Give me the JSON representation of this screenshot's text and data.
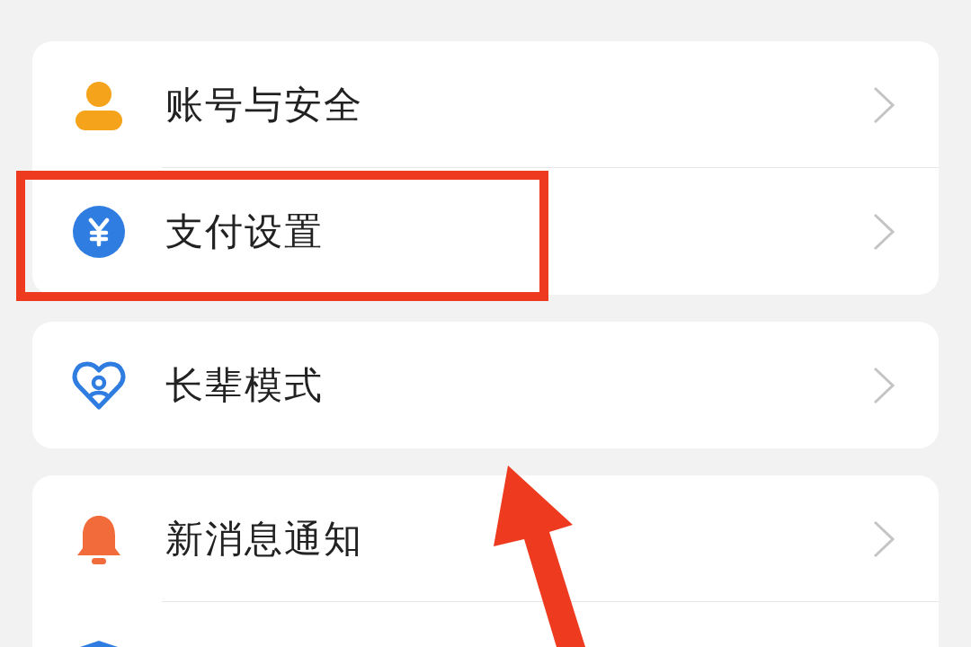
{
  "groups": [
    {
      "items": [
        {
          "kind": "account",
          "label": "账号与安全"
        },
        {
          "kind": "payment",
          "label": "支付设置"
        }
      ]
    },
    {
      "items": [
        {
          "kind": "elder",
          "label": "长辈模式"
        }
      ]
    },
    {
      "items": [
        {
          "kind": "notification",
          "label": "新消息通知"
        },
        {
          "kind": "shield"
        }
      ]
    }
  ],
  "annotations": {
    "highlight_frame": true,
    "arrow": true
  }
}
